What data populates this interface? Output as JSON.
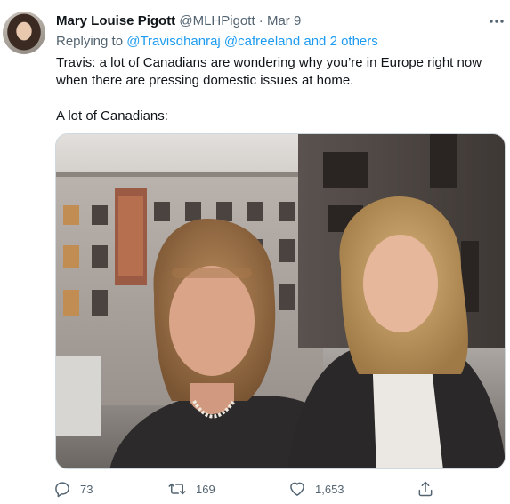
{
  "tweet": {
    "display_name": "Mary Louise Pigott",
    "handle": "@MLHPigott",
    "separator": "·",
    "timestamp": "Mar 9",
    "reply": {
      "prefix": "Replying to",
      "mentions": "@Travisdhanraj @cafreeland and 2 others"
    },
    "text_paragraph_1": "Travis: a lot of Canadians are wondering why you’re in Europe right now when there are pressing domestic issues at home.",
    "text_paragraph_2": "A lot of Canadians:",
    "more_icon": "more-horizontal-icon",
    "actions": {
      "reply": {
        "icon": "reply-icon",
        "count": "73"
      },
      "retweet": {
        "icon": "retweet-icon",
        "count": "169"
      },
      "like": {
        "icon": "heart-icon",
        "count": "1,653"
      },
      "share": {
        "icon": "share-icon"
      }
    },
    "colors": {
      "link": "#1d9bf0",
      "secondary_text": "#536471",
      "primary_text": "#0f1419"
    }
  }
}
